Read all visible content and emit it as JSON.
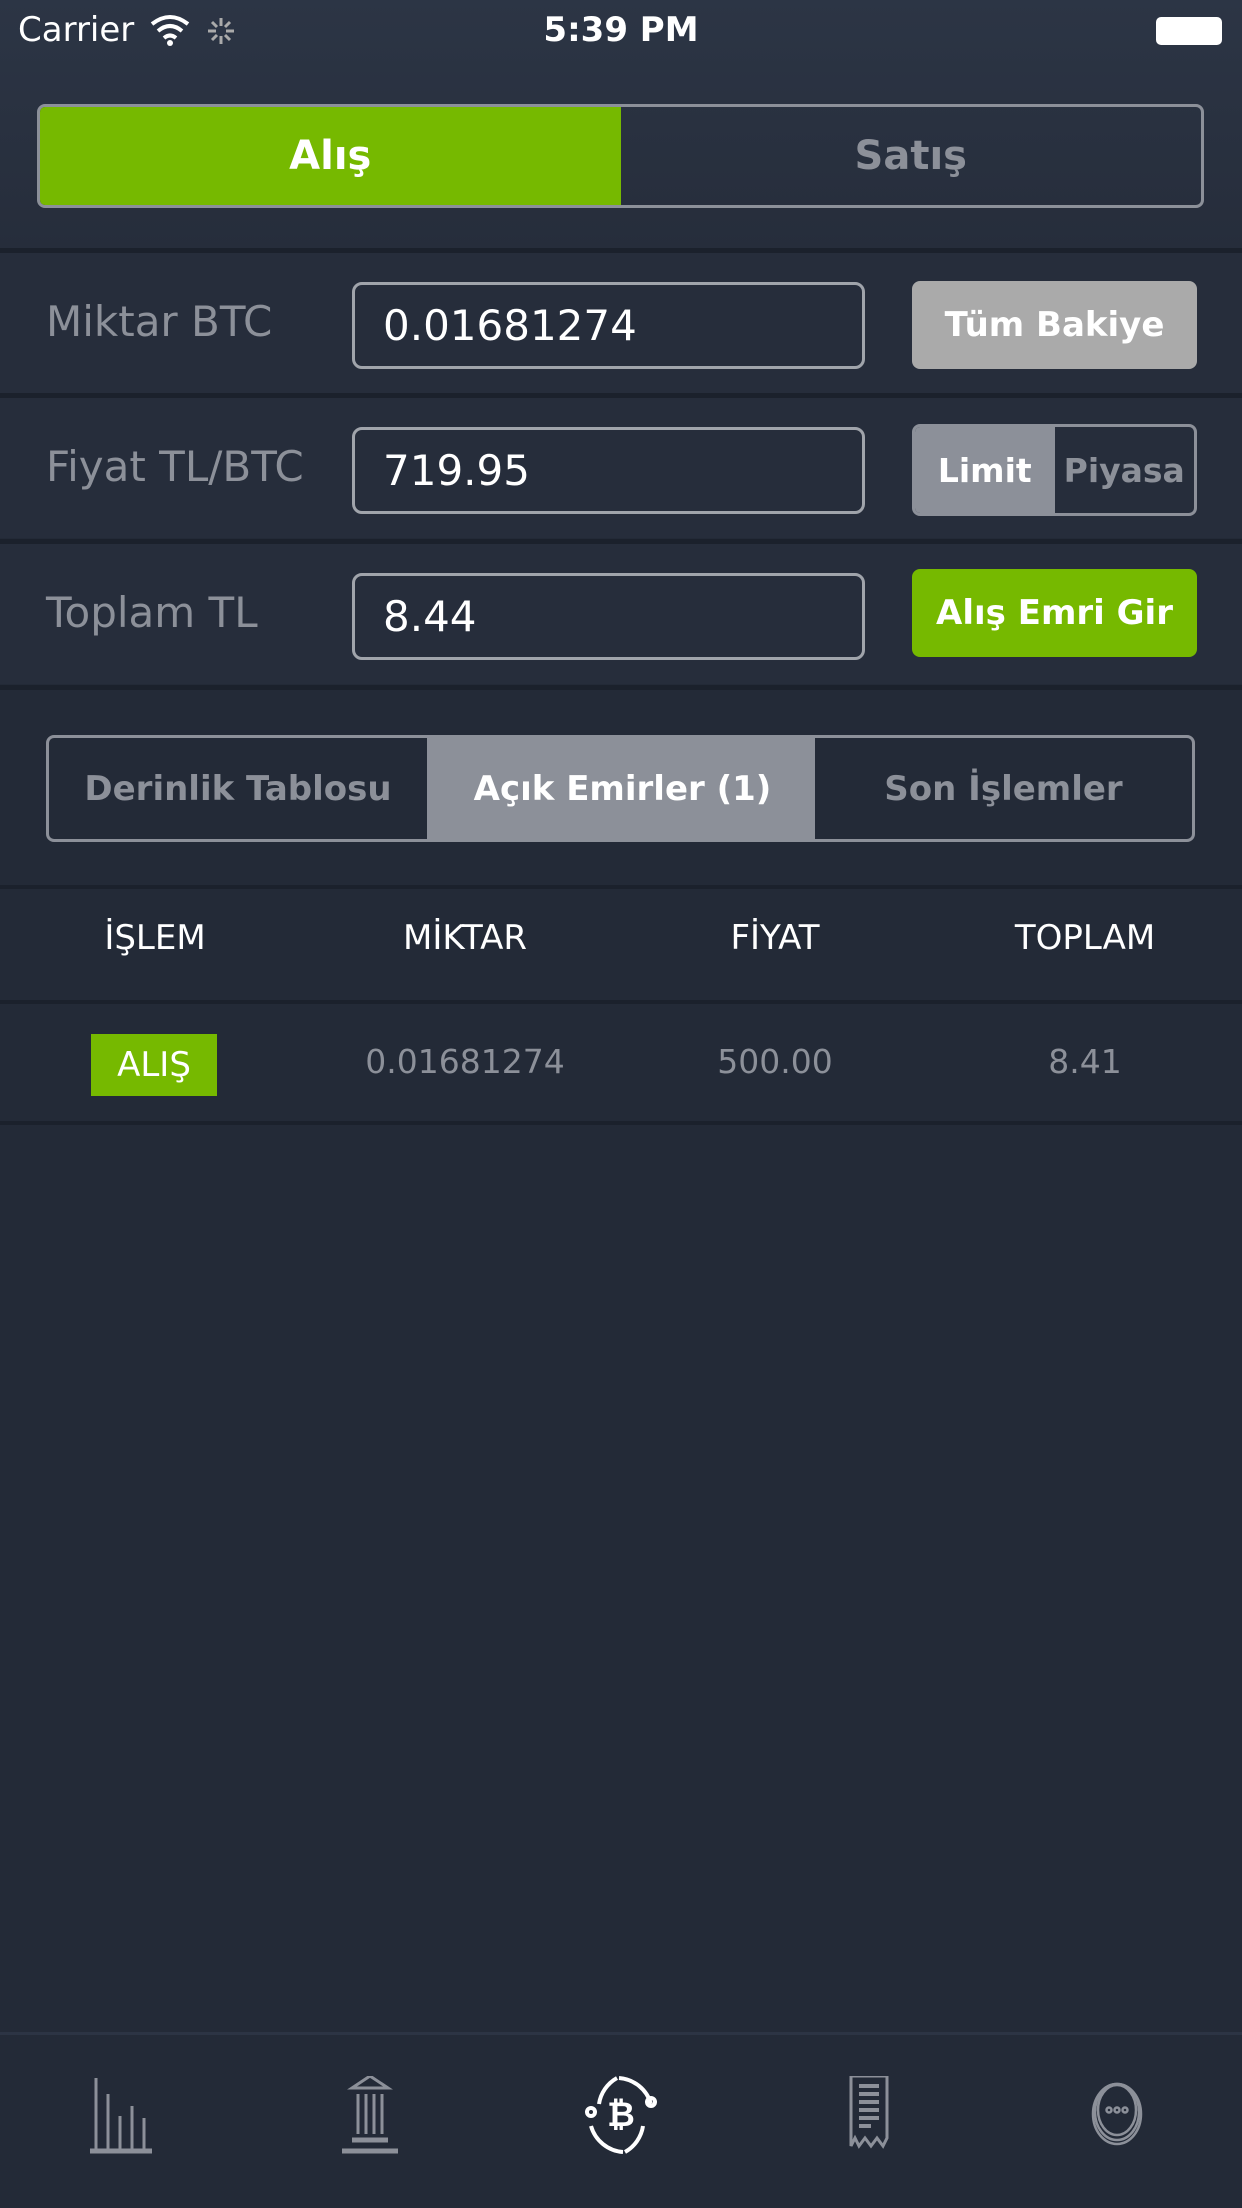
{
  "status_bar": {
    "carrier": "Carrier",
    "time": "5:39 PM"
  },
  "mode_toggle": {
    "buy": "Alış",
    "sell": "Satış",
    "selected": "buy"
  },
  "form": {
    "amount": {
      "label": "Miktar BTC",
      "value": "0.01681274",
      "button": "Tüm Bakiye"
    },
    "price": {
      "label": "Fiyat TL/BTC",
      "value": "719.95",
      "limit": "Limit",
      "market": "Piyasa",
      "selected": "limit"
    },
    "total": {
      "label": "Toplam TL",
      "value": "8.44",
      "button": "Alış Emri Gir"
    }
  },
  "tabs": {
    "items": [
      "Derinlik Tablosu",
      "Açık Emirler (1)",
      "Son İşlemler"
    ],
    "selected": 1
  },
  "table": {
    "columns": [
      "İŞLEM",
      "MİKTAR",
      "FİYAT",
      "TOPLAM"
    ],
    "rows": [
      {
        "type": "ALIŞ",
        "amount": "0.01681274",
        "price": "500.00",
        "total": "8.41"
      }
    ]
  },
  "tab_bar": {
    "icons": [
      "chart-icon",
      "bank-icon",
      "bitcoin-exchange-icon",
      "receipt-icon",
      "more-icon"
    ],
    "selected": 2
  },
  "colors": {
    "accent": "#76b900",
    "background": "#232a37",
    "muted": "#8c9099"
  }
}
